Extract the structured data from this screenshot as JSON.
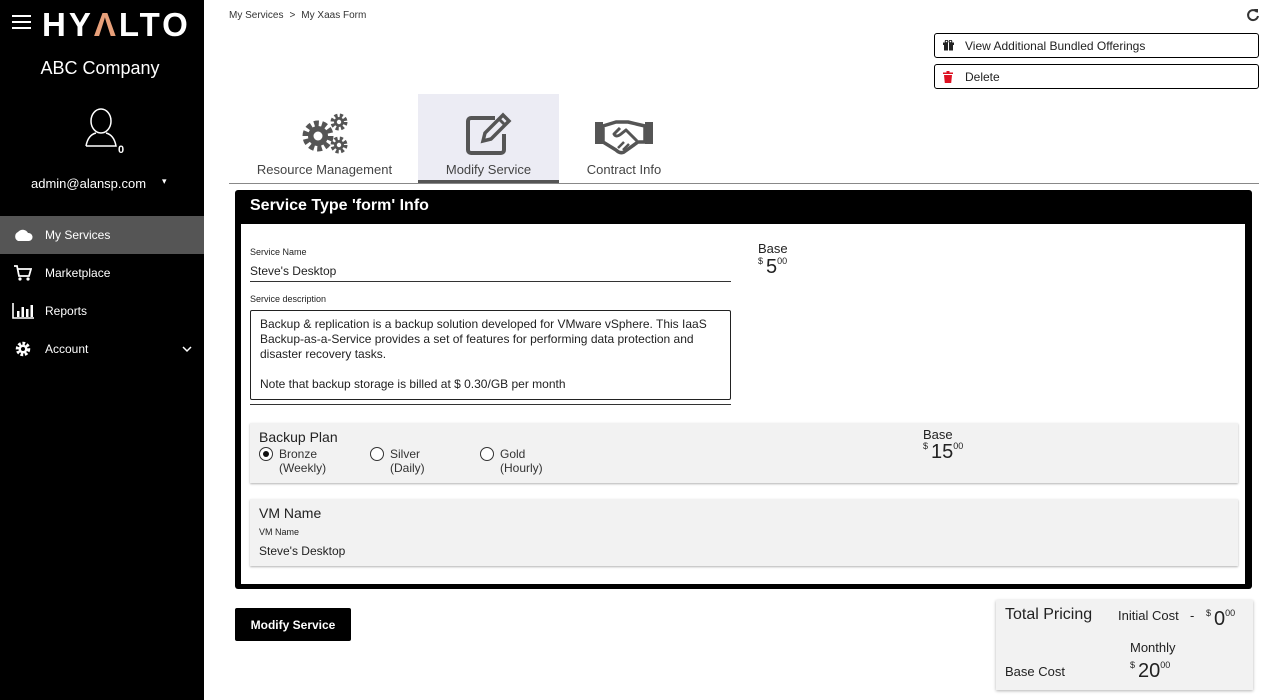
{
  "brand": {
    "logo_left": "HY",
    "logo_accent": "Λ",
    "logo_right": "LTO",
    "company": "ABC Company"
  },
  "user": {
    "avatar_count": "0",
    "email": "admin@alansp.com",
    "caret": "▾"
  },
  "nav": [
    {
      "label": "My Services",
      "icon": "cloud-icon"
    },
    {
      "label": "Marketplace",
      "icon": "cart-icon"
    },
    {
      "label": "Reports",
      "icon": "bar-chart-icon"
    },
    {
      "label": "Account",
      "icon": "gear-icon"
    }
  ],
  "breadcrumb": {
    "parent": "My Services",
    "separator": ">",
    "current": "My Xaas Form"
  },
  "actions": {
    "bundled": "View Additional Bundled Offerings",
    "delete": "Delete"
  },
  "tabs": [
    {
      "label": "Resource Management",
      "icon": "gears-icon"
    },
    {
      "label": "Modify Service",
      "icon": "edit-icon"
    },
    {
      "label": "Contract Info",
      "icon": "handshake-icon"
    }
  ],
  "form": {
    "title": "Service Type 'form' Info",
    "service_name_label": "Service Name",
    "service_name": "Steve's Desktop",
    "description_label": "Service description",
    "description": "Backup & replication is a backup solution developed for VMware vSphere. This IaaS Backup-as-a-Service provides a set of features for performing data protection and disaster recovery tasks.\n\nNote that backup storage is billed at $ 0.30/GB per month",
    "base_label": "Base",
    "base_currency": "$",
    "base_price": "5",
    "base_cents": "00"
  },
  "backup_plan": {
    "title": "Backup Plan",
    "options": [
      {
        "label": "Bronze",
        "sub": "(Weekly)",
        "selected": true
      },
      {
        "label": "Silver",
        "sub": "(Daily)",
        "selected": false
      },
      {
        "label": "Gold",
        "sub": "(Hourly)",
        "selected": false
      }
    ],
    "base_label": "Base",
    "currency": "$",
    "price": "15",
    "cents": "00"
  },
  "vm": {
    "title": "VM Name",
    "label": "VM Name",
    "value": "Steve's Desktop"
  },
  "submit": "Modify Service",
  "pricing": {
    "title": "Total Pricing",
    "initial_label": "Initial Cost",
    "dash": "-",
    "initial_currency": "$",
    "initial_price": "0",
    "initial_cents": "00",
    "monthly_label": "Monthly",
    "base_cost_label": "Base Cost",
    "monthly_currency": "$",
    "monthly_price": "20",
    "monthly_cents": "00"
  }
}
